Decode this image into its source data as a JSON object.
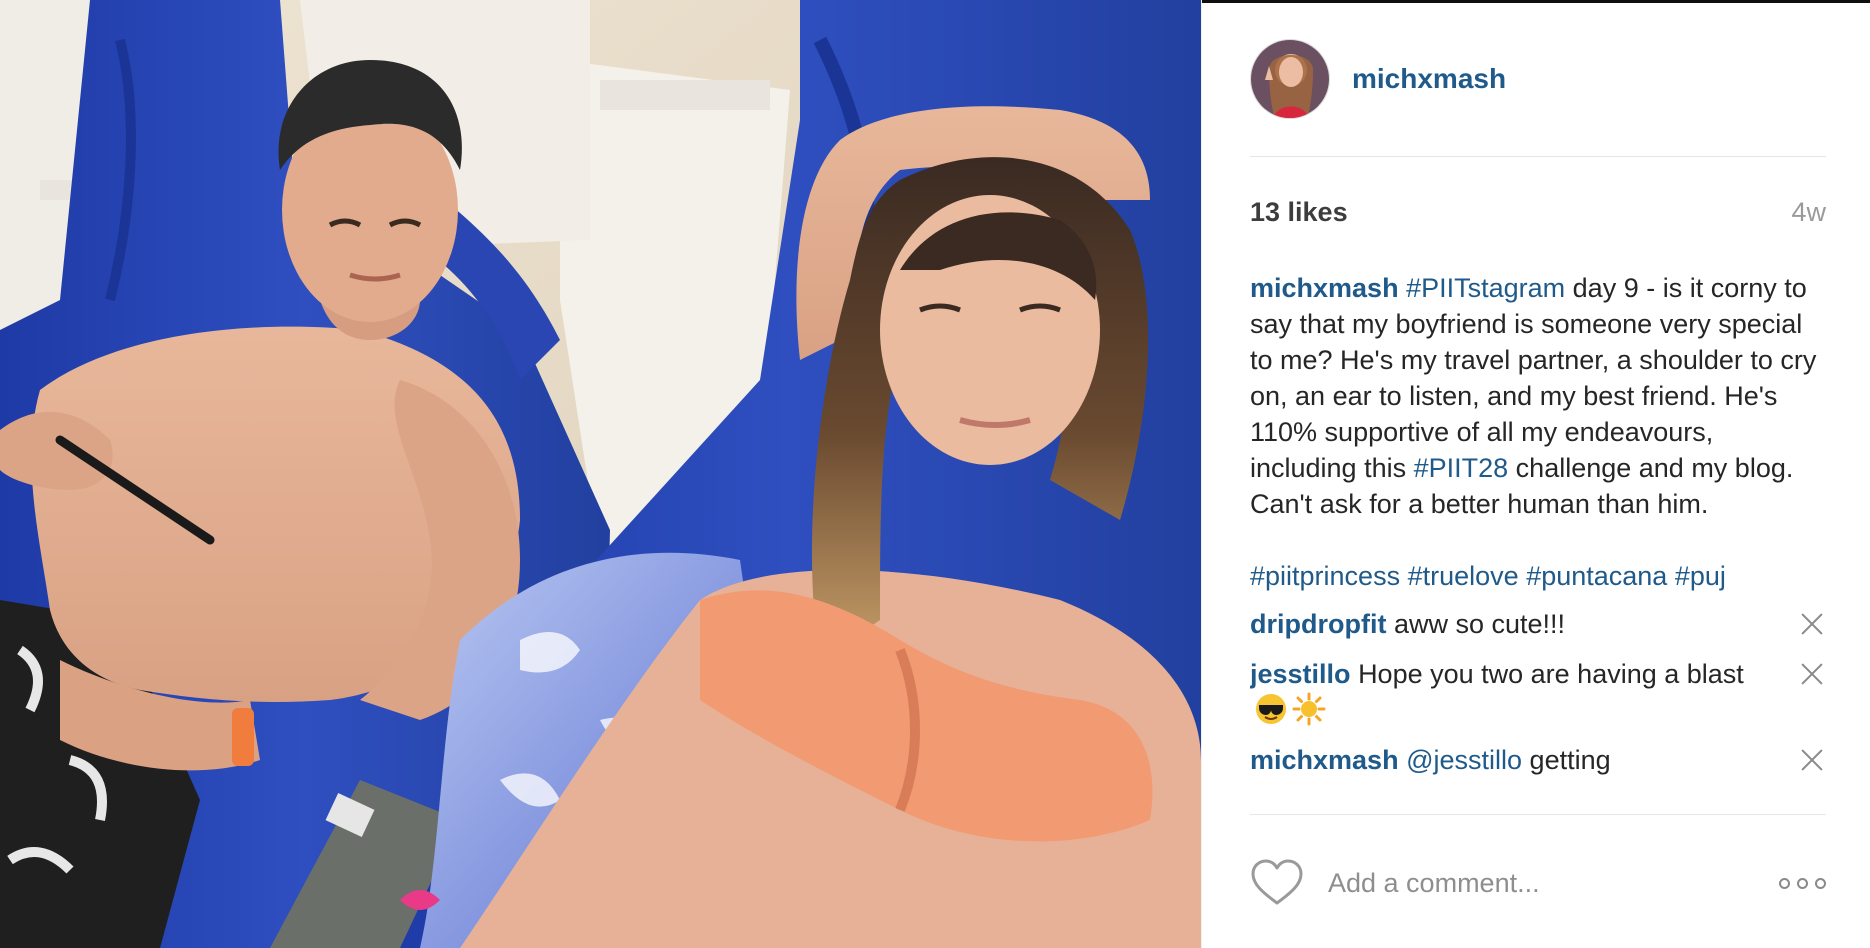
{
  "post": {
    "username": "michxmash",
    "likes": "13 likes",
    "time_ago": "4w",
    "caption": {
      "username": "michxmash",
      "hashtag1": "#PIITstagram",
      "text1": " day 9 - is it corny to say that my boyfriend is someone very special to me? He's my travel partner, a shoulder to cry on, an ear to listen, and my best friend. He's 110% supportive of all my endeavours, including this ",
      "hashtag2": "#PIIT28",
      "text2": " challenge and my blog. Can't ask for a better human than him.",
      "tags": [
        "#piitprincess",
        "#truelove",
        "#puntacana",
        "#puj"
      ]
    },
    "comments": [
      {
        "username": "dripdropfit",
        "text": "aww so cute!!!"
      },
      {
        "username": "jesstillo",
        "text": "Hope you two are having a blast",
        "emojis": [
          "sunglasses-face-emoji",
          "sun-emoji"
        ]
      },
      {
        "username": "michxmash",
        "mention": "@jesstillo",
        "text": "getting"
      }
    ],
    "add_comment_placeholder": "Add a comment...",
    "icons": {
      "like": "heart-icon",
      "more": "more-options-icon",
      "remove": "close-icon"
    }
  },
  "colors": {
    "link": "#1f5a8a",
    "muted": "#9a9a9a",
    "towel": "#2f4fc0",
    "bikini": "#f29a72"
  }
}
